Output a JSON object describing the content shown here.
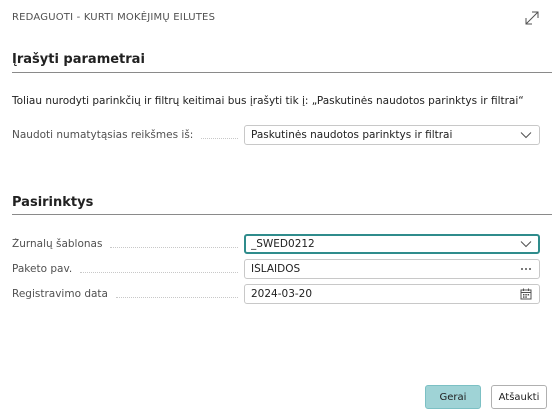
{
  "dialog": {
    "title": "REDAGUOTI - KURTI MOKĖJIMŲ EILUTES"
  },
  "section_params": {
    "title": "Įrašyti parametrai",
    "info": "Toliau nurodyti parinkčių ir filtrų keitimai bus įrašyti tik į: „Paskutinės naudotos parinktys ir filtrai“",
    "defaults_label": "Naudoti numatytąsias reikšmes iš:",
    "defaults_value": "Paskutinės naudotos parinktys ir filtrai"
  },
  "section_options": {
    "title": "Pasirinktys",
    "journal_template_label": "Žurnalų šablonas",
    "journal_template_value": "_SWED0212",
    "batch_name_label": "Paketo pav.",
    "batch_name_value": "IŠLAIDOS",
    "posting_date_label": "Registravimo data",
    "posting_date_value": "2024-03-20"
  },
  "buttons": {
    "ok_label": "Gerai",
    "cancel_label": "Atšaukti"
  },
  "icons": {
    "expand": "expand-icon",
    "dropdown": "chevron-down-icon",
    "lookup": "ellipsis-icon",
    "calendar": "calendar-icon"
  },
  "colors": {
    "focus_border": "#2f8c8c",
    "primary_button": "#9fd3d6"
  }
}
